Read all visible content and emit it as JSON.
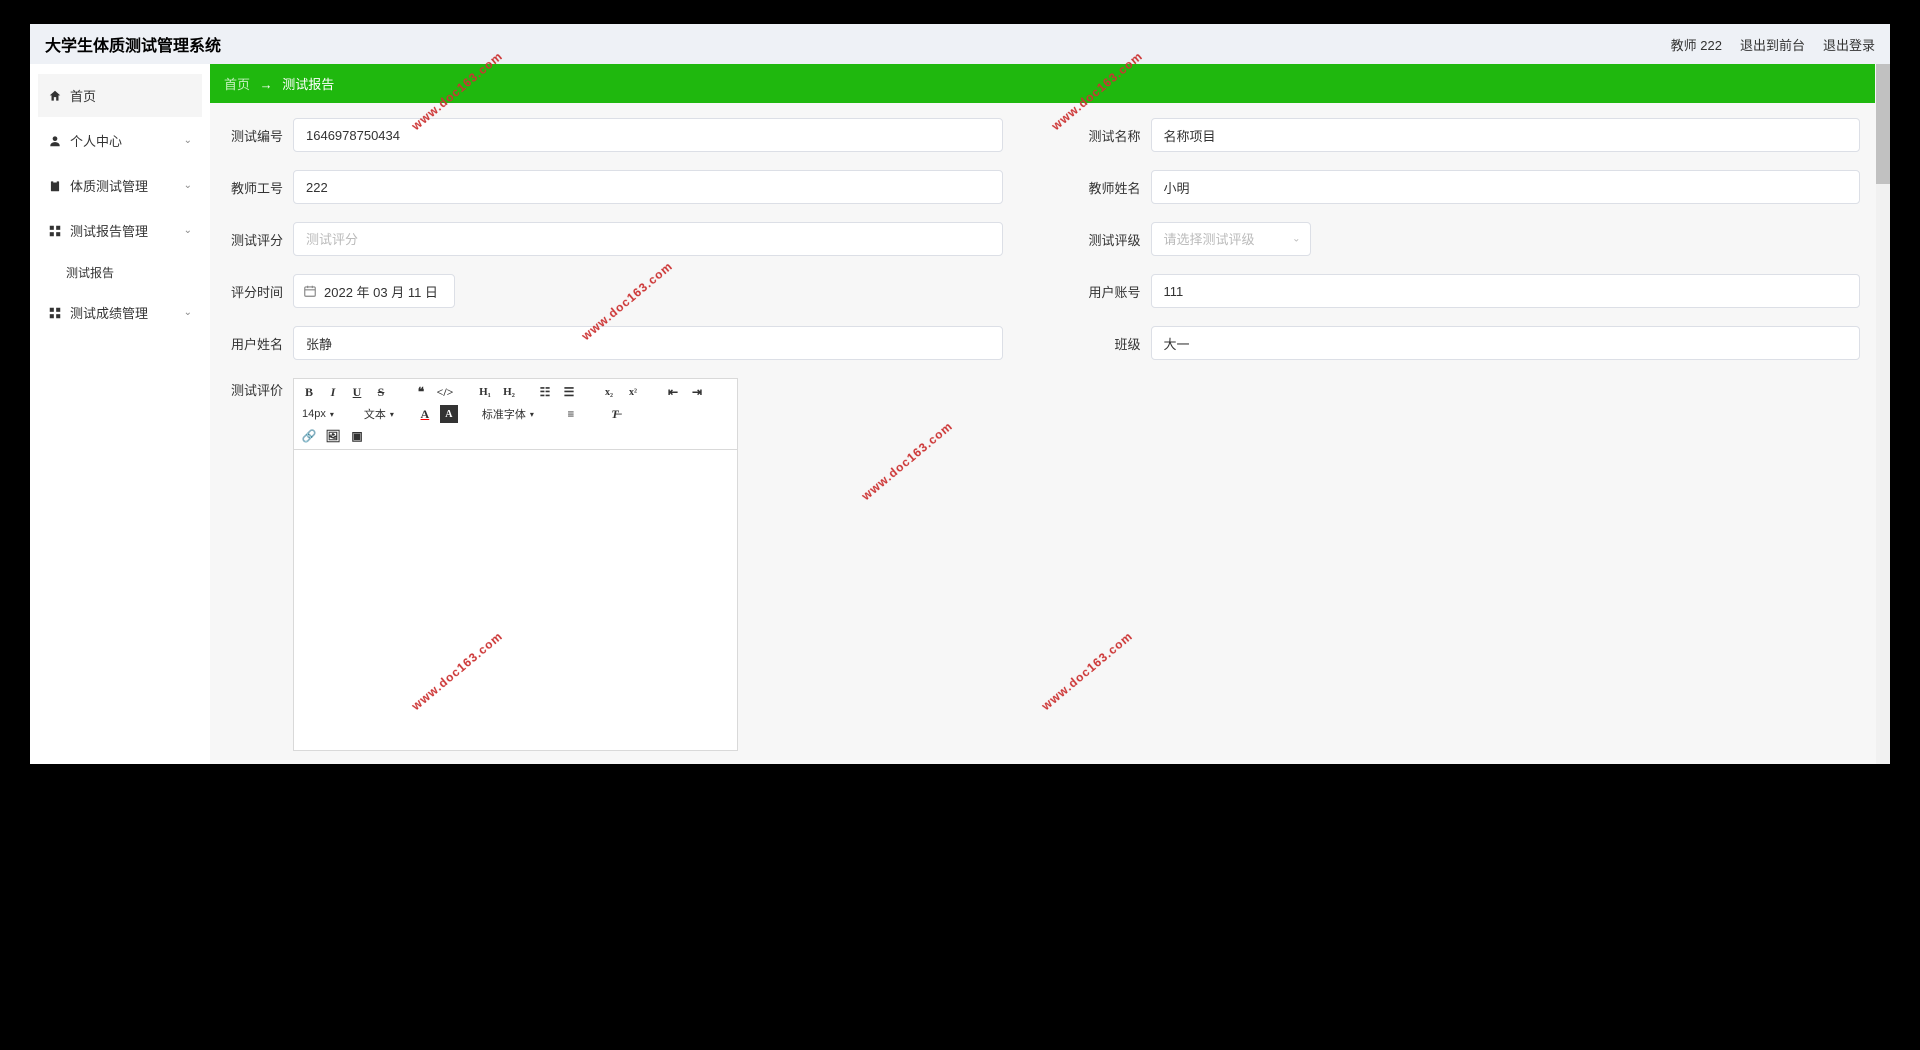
{
  "app_title": "大学生体质测试管理系统",
  "header": {
    "user": "教师 222",
    "logout_front": "退出到前台",
    "logout": "退出登录"
  },
  "sidebar": {
    "home": "首页",
    "personal": "个人中心",
    "physical": "体质测试管理",
    "report_mgmt": "测试报告管理",
    "report_sub": "测试报告",
    "score_mgmt": "测试成绩管理"
  },
  "breadcrumb": {
    "home": "首页",
    "arrow": "→",
    "current": "测试报告"
  },
  "form": {
    "test_no": {
      "label": "测试编号",
      "value": "1646978750434"
    },
    "test_name": {
      "label": "测试名称",
      "value": "名称项目"
    },
    "teacher_no": {
      "label": "教师工号",
      "value": "222"
    },
    "teacher_name": {
      "label": "教师姓名",
      "value": "小明"
    },
    "test_score": {
      "label": "测试评分",
      "placeholder": "测试评分"
    },
    "test_grade": {
      "label": "测试评级",
      "placeholder": "请选择测试评级"
    },
    "score_time": {
      "label": "评分时间",
      "value": "2022 年 03 月 11 日"
    },
    "user_account": {
      "label": "用户账号",
      "value": "111"
    },
    "user_name": {
      "label": "用户姓名",
      "value": "张静"
    },
    "class": {
      "label": "班级",
      "value": "大一"
    },
    "test_eval": {
      "label": "测试评价"
    }
  },
  "toolbar": {
    "font_size": "14px",
    "text": "文本",
    "standard_font": "标准字体"
  },
  "watermark": "www.doc163.com"
}
